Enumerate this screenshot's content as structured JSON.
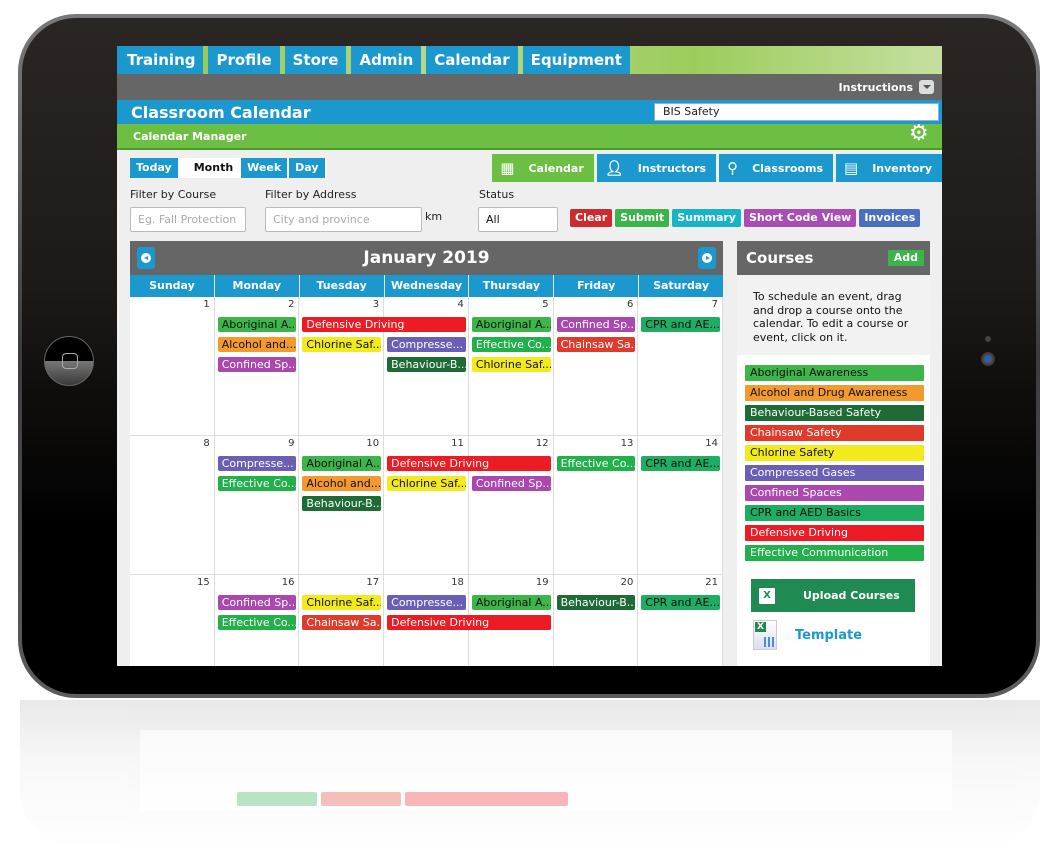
{
  "top_nav": [
    "Training",
    "Profile",
    "Store",
    "Admin",
    "Calendar",
    "Equipment"
  ],
  "instructions_label": "Instructions",
  "page_title": "Classroom Calendar",
  "company_field_value": "BIS Safety",
  "subheader": "Calendar Manager",
  "view_buttons": {
    "today": "Today",
    "month": "Month",
    "week": "Week",
    "day": "Day",
    "active": "Month"
  },
  "right_tabs": [
    {
      "label": "Calendar",
      "icon": "calendar-icon",
      "active": true
    },
    {
      "label": "Instructors",
      "icon": "person-icon",
      "active": false
    },
    {
      "label": "Classrooms",
      "icon": "map-pin-icon",
      "active": false
    },
    {
      "label": "Inventory",
      "icon": "clipboard-icon",
      "active": false
    }
  ],
  "filters": {
    "course_label": "Filter by Course",
    "course_placeholder": "Eg. Fall Protection",
    "address_label": "Filter by Address",
    "address_placeholder": "City and province",
    "unit": "km",
    "status_label": "Status",
    "status_value": "All"
  },
  "action_buttons": [
    {
      "label": "Clear",
      "color": "#cc2b2f"
    },
    {
      "label": "Submit",
      "color": "#3bb54a"
    },
    {
      "label": "Summary",
      "color": "#17b3c9"
    },
    {
      "label": "Short Code View",
      "color": "#a94cb5"
    },
    {
      "label": "Invoices",
      "color": "#4a6fbf"
    }
  ],
  "calendar": {
    "month_label": "January 2019",
    "days_of_week": [
      "Sunday",
      "Monday",
      "Tuesday",
      "Wednesday",
      "Thursday",
      "Friday",
      "Saturday"
    ],
    "weeks": [
      {
        "dates": [
          "1",
          "2",
          "3",
          "4",
          "5",
          "6",
          "7"
        ],
        "events": [
          {
            "label": "Aboriginal A...",
            "day": 1,
            "span": 1,
            "row": 0,
            "course": 0
          },
          {
            "label": "Alcohol and...",
            "day": 1,
            "span": 1,
            "row": 1,
            "course": 1
          },
          {
            "label": "Confined Sp...",
            "day": 1,
            "span": 1,
            "row": 2,
            "course": 6
          },
          {
            "label": "Defensive Driving",
            "day": 2,
            "span": 2,
            "row": 0,
            "course": 8
          },
          {
            "label": "Chlorine Saf...",
            "day": 2,
            "span": 1,
            "row": 1,
            "course": 4
          },
          {
            "label": "Compresse...",
            "day": 3,
            "span": 1,
            "row": 1,
            "course": 5
          },
          {
            "label": "Behaviour-B...",
            "day": 3,
            "span": 1,
            "row": 2,
            "course": 2
          },
          {
            "label": "Aboriginal A...",
            "day": 4,
            "span": 1,
            "row": 0,
            "course": 0
          },
          {
            "label": "Effective Co...",
            "day": 4,
            "span": 1,
            "row": 1,
            "course": 9
          },
          {
            "label": "Chlorine Saf...",
            "day": 4,
            "span": 1,
            "row": 2,
            "course": 4
          },
          {
            "label": "Confined Sp...",
            "day": 5,
            "span": 1,
            "row": 0,
            "course": 6
          },
          {
            "label": "Chainsaw Sa...",
            "day": 5,
            "span": 1,
            "row": 1,
            "course": 3
          },
          {
            "label": "CPR and AE...",
            "day": 6,
            "span": 1,
            "row": 0,
            "course": 7
          }
        ]
      },
      {
        "dates": [
          "8",
          "9",
          "10",
          "11",
          "12",
          "13",
          "14"
        ],
        "events": [
          {
            "label": "Compresse...",
            "day": 1,
            "span": 1,
            "row": 0,
            "course": 5
          },
          {
            "label": "Effective Co...",
            "day": 1,
            "span": 1,
            "row": 1,
            "course": 9
          },
          {
            "label": "Aboriginal A...",
            "day": 2,
            "span": 1,
            "row": 0,
            "course": 0
          },
          {
            "label": "Alcohol and...",
            "day": 2,
            "span": 1,
            "row": 1,
            "course": 1
          },
          {
            "label": "Behaviour-B...",
            "day": 2,
            "span": 1,
            "row": 2,
            "course": 2
          },
          {
            "label": "Defensive Driving",
            "day": 3,
            "span": 2,
            "row": 0,
            "course": 8
          },
          {
            "label": "Chlorine Saf...",
            "day": 3,
            "span": 1,
            "row": 1,
            "course": 4
          },
          {
            "label": "Confined Sp...",
            "day": 4,
            "span": 1,
            "row": 1,
            "course": 6
          },
          {
            "label": "Effective Co...",
            "day": 5,
            "span": 1,
            "row": 0,
            "course": 9
          },
          {
            "label": "CPR and AE...",
            "day": 6,
            "span": 1,
            "row": 0,
            "course": 7
          }
        ]
      },
      {
        "dates": [
          "15",
          "16",
          "17",
          "18",
          "19",
          "20",
          "21"
        ],
        "events": [
          {
            "label": "Confined Sp...",
            "day": 1,
            "span": 1,
            "row": 0,
            "course": 6
          },
          {
            "label": "Effective Co...",
            "day": 1,
            "span": 1,
            "row": 1,
            "course": 9
          },
          {
            "label": "Chlorine Saf...",
            "day": 2,
            "span": 1,
            "row": 0,
            "course": 4
          },
          {
            "label": "Chainsaw Sa...",
            "day": 2,
            "span": 1,
            "row": 1,
            "course": 3
          },
          {
            "label": "Compresse...",
            "day": 3,
            "span": 1,
            "row": 0,
            "course": 5
          },
          {
            "label": "Defensive Driving",
            "day": 3,
            "span": 2,
            "row": 1,
            "course": 8
          },
          {
            "label": "Aboriginal A...",
            "day": 4,
            "span": 1,
            "row": 0,
            "course": 0
          },
          {
            "label": "Behaviour-B...",
            "day": 5,
            "span": 1,
            "row": 0,
            "course": 2
          },
          {
            "label": "CPR and AE...",
            "day": 6,
            "span": 1,
            "row": 0,
            "course": 7
          }
        ]
      }
    ]
  },
  "courses_panel": {
    "title": "Courses",
    "add_label": "Add",
    "instructions": "To schedule an event, drag and drop a course onto the calendar. To edit a course or event, click on it.",
    "courses": [
      {
        "name": "Aboriginal Awareness",
        "bg": "#3db54a",
        "fg": "#111"
      },
      {
        "name": "Alcohol and Drug Awareness",
        "bg": "#f29a2e",
        "fg": "#111"
      },
      {
        "name": "Behaviour-Based Safety",
        "bg": "#1e6b35",
        "fg": "#fff"
      },
      {
        "name": "Chainsaw Safety",
        "bg": "#e03a2a",
        "fg": "#fff"
      },
      {
        "name": "Chlorine Safety",
        "bg": "#f2ea1c",
        "fg": "#111"
      },
      {
        "name": "Compressed Gases",
        "bg": "#6a5fb5",
        "fg": "#fff"
      },
      {
        "name": "Confined Spaces",
        "bg": "#aa48b0",
        "fg": "#fff"
      },
      {
        "name": "CPR and AED Basics",
        "bg": "#1fac63",
        "fg": "#111"
      },
      {
        "name": "Defensive Driving",
        "bg": "#ed1c24",
        "fg": "#fff"
      },
      {
        "name": "Effective Communication",
        "bg": "#22b04b",
        "fg": "#fff"
      }
    ],
    "upload_label": "Upload Courses",
    "template_label": "Template"
  }
}
